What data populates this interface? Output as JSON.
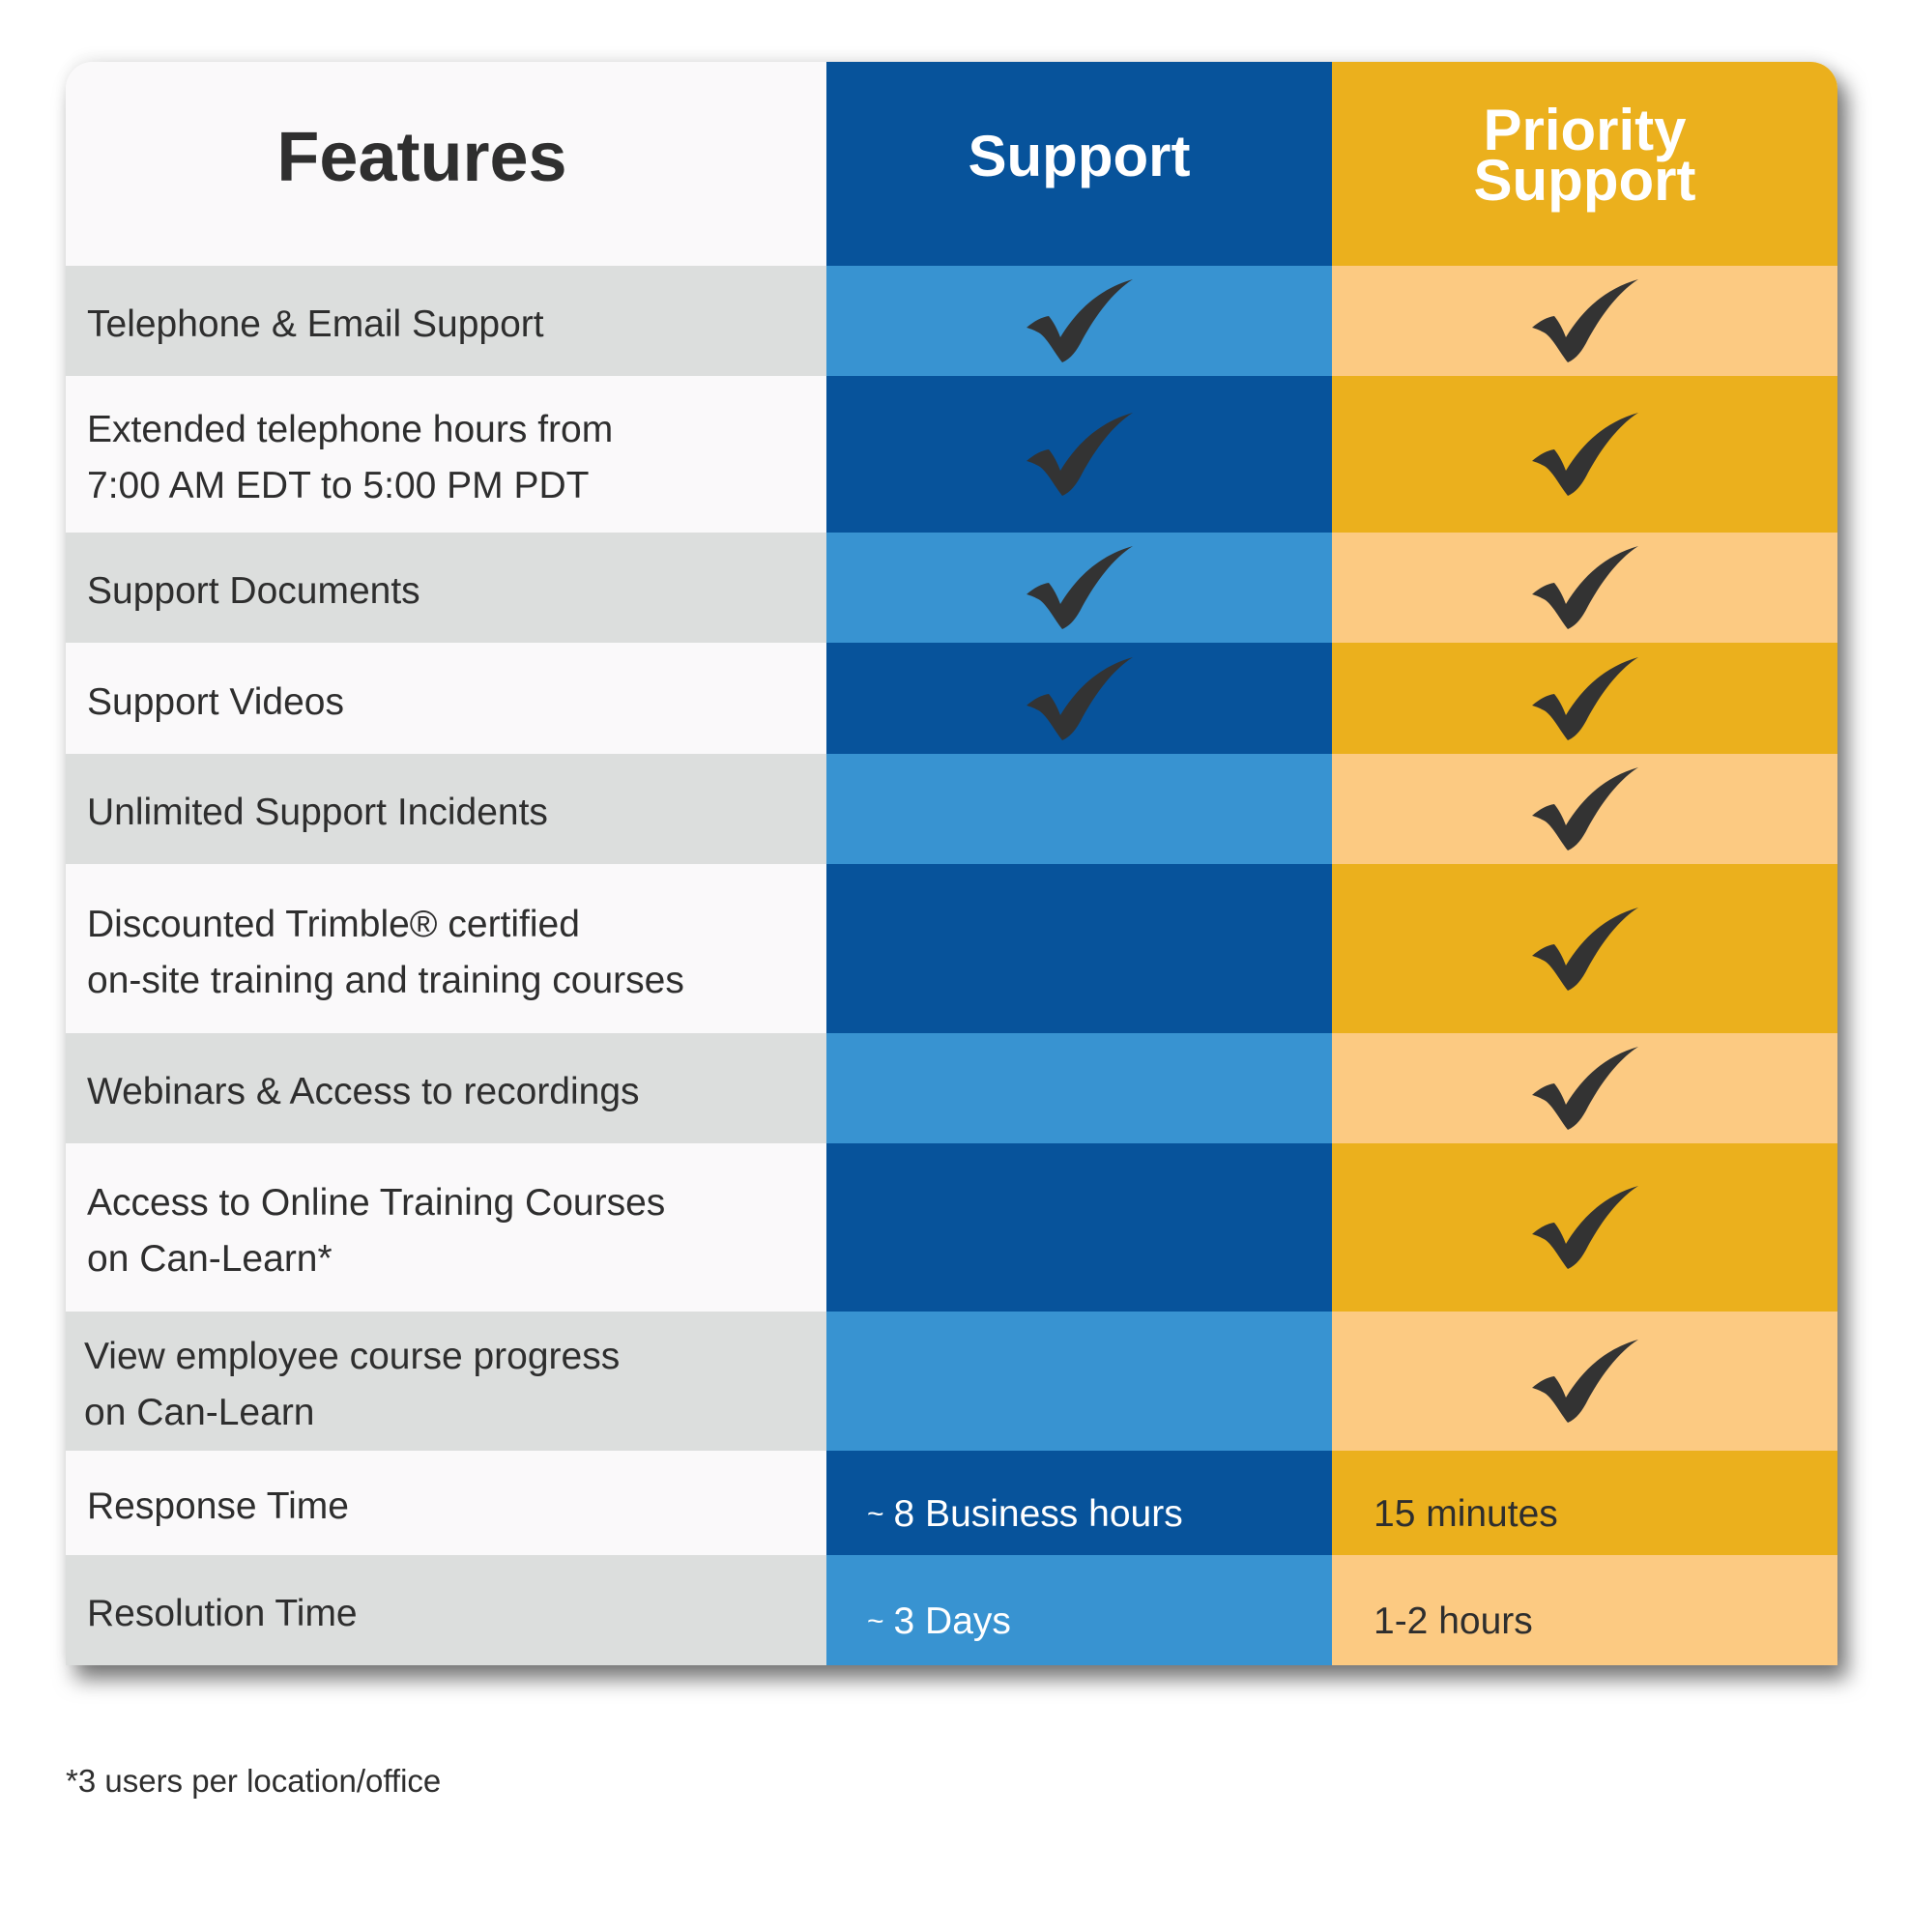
{
  "header": {
    "features": "Features",
    "support": "Support",
    "priority_line1": "Priority",
    "priority_line2": "Support"
  },
  "colors": {
    "support_dark": "#07539b",
    "support_light": "#3893d1",
    "priority_dark": "#ebb01d",
    "priority_light": "#fcca82",
    "feature_gray": "#dcdedd",
    "feature_white": "#faf9fa",
    "text": "#2e2e2e"
  },
  "rows": [
    {
      "feature": "Telephone & Email Support",
      "support": true,
      "priority": true
    },
    {
      "feature": "Extended telephone hours from\n7:00 AM EDT to 5:00 PM PDT",
      "support": true,
      "priority": true
    },
    {
      "feature": "Support Documents",
      "support": true,
      "priority": true
    },
    {
      "feature": "Support Videos",
      "support": true,
      "priority": true
    },
    {
      "feature": "Unlimited Support Incidents",
      "support": false,
      "priority": true
    },
    {
      "feature": "Discounted Trimble® certified\non-site training and training courses",
      "support": false,
      "priority": true
    },
    {
      "feature": "Webinars & Access to recordings",
      "support": false,
      "priority": true
    },
    {
      "feature": "Access to Online Training Courses\non Can-Learn*",
      "support": false,
      "priority": true
    },
    {
      "feature": "View employee course progress\non Can-Learn",
      "support": false,
      "priority": true
    },
    {
      "feature": "Response Time",
      "support_text": "~ 8 Business hours",
      "priority_text": "15 minutes"
    },
    {
      "feature": "Resolution Time",
      "support_text": "~ 3 Days",
      "priority_text": "1-2 hours"
    }
  ],
  "values": {
    "response_support": "8 Business hours",
    "response_priority": "15 minutes",
    "resolution_support": "3 Days",
    "resolution_priority": "1-2 hours",
    "approx_symbol": "~"
  },
  "footnote": "*3 users per location/office",
  "icons": {
    "included": "checkmark-icon"
  }
}
